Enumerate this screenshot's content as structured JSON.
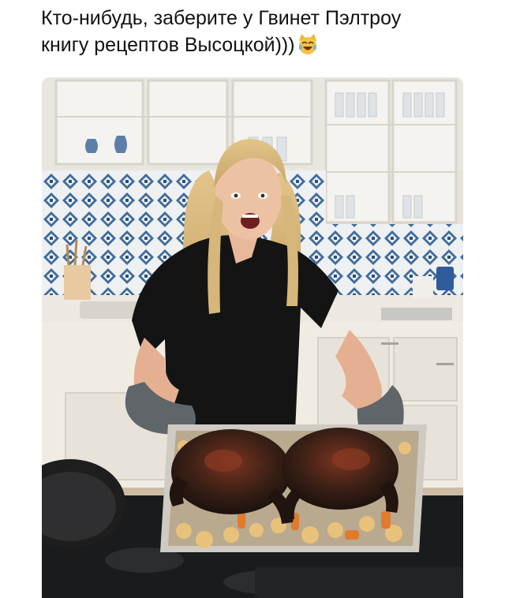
{
  "post": {
    "caption_line1": "Кто-нибудь, заберите у Гвинет Пэлтроу",
    "caption_line2": "книгу рецептов Высоцкой)))",
    "caption_emoji": "laughing-cat-emoji"
  },
  "photo": {
    "subject": "woman holding a baking tray with two burnt roasted chickens in a kitchen"
  },
  "colors": {
    "background": "#ffffff",
    "caption_text": "#111111",
    "tile_blue": "#3f6c9c",
    "cabinet": "#ece8e0",
    "burnt_chicken": "#2a1a14"
  }
}
